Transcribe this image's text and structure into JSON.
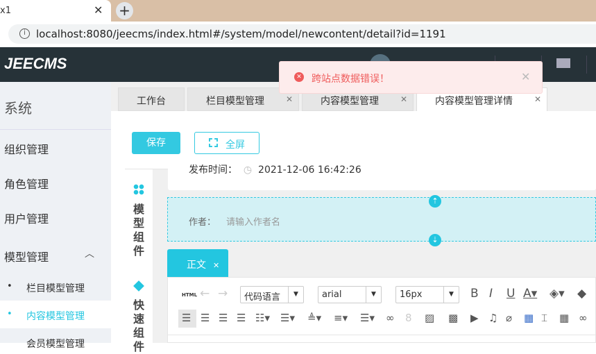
{
  "browser": {
    "tab_title": "x1",
    "address": "localhost:8080/jeecms/index.html#/system/model/newcontent/detail?id=1191"
  },
  "header": {
    "logo": "JEECMS"
  },
  "toast": {
    "message": "跨站点数据错误！"
  },
  "sidebar": {
    "title": "系统",
    "items": [
      {
        "label": "组织管理"
      },
      {
        "label": "角色管理"
      },
      {
        "label": "用户管理"
      },
      {
        "label": "模型管理"
      }
    ],
    "sub_items": [
      {
        "label": "栏目模型管理"
      },
      {
        "label": "内容模型管理"
      },
      {
        "label": "会员模型管理"
      }
    ]
  },
  "tabs": [
    {
      "label": "工作台"
    },
    {
      "label": "栏目模型管理"
    },
    {
      "label": "内容模型管理"
    },
    {
      "label": "内容模型管理详情"
    }
  ],
  "toolbar": {
    "save": "保存",
    "fullscreen": "全屏"
  },
  "left_panel": {
    "model_components": "模型组件",
    "quick_components": "快速组件"
  },
  "form": {
    "publish_label": "发布时间：",
    "publish_value": "2021-12-06 16:42:26",
    "author_label": "作者：",
    "author_placeholder": "请输入作者名",
    "body_tab": "正文"
  },
  "editor": {
    "html": "HTML",
    "code_lang": "代码语言",
    "font": "arial",
    "size": "16px"
  },
  "colors": {
    "accent": "#23c6e0",
    "toast": "#ef5b5b",
    "nav": "#263238"
  }
}
